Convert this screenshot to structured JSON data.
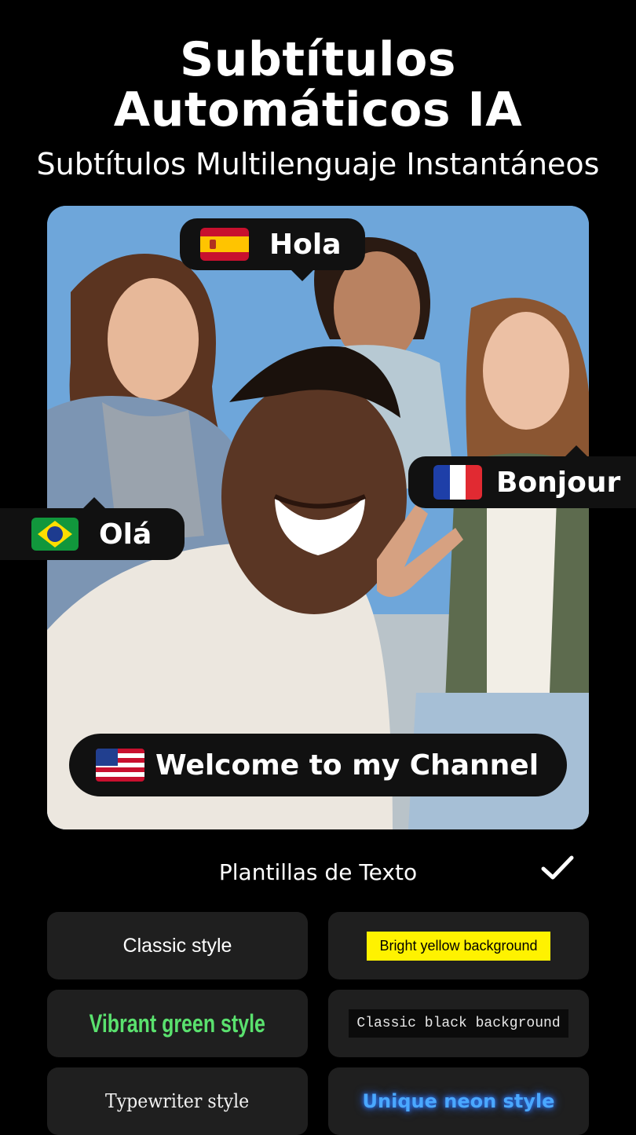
{
  "header": {
    "title_line1": "Subtítulos",
    "title_line2": "Automáticos IA",
    "subtitle": "Subtítulos Multilenguaje Instantáneos"
  },
  "bubbles": {
    "spanish": {
      "text": "Hola",
      "flag": "spain-flag-icon"
    },
    "french": {
      "text": "Bonjour",
      "flag": "france-flag-icon"
    },
    "portuguese": {
      "text": "Olá",
      "flag": "brazil-flag-icon"
    },
    "english": {
      "text": "Welcome to my Channel",
      "flag": "usa-flag-icon"
    }
  },
  "templates": {
    "heading": "Plantillas de Texto",
    "confirm_icon": "checkmark-icon",
    "items": [
      {
        "label": "Classic style"
      },
      {
        "label": "Bright yellow background"
      },
      {
        "label": "Vibrant green style"
      },
      {
        "label": "Classic black background"
      },
      {
        "label": "Typewriter style"
      },
      {
        "label": "Unique neon style"
      }
    ]
  },
  "colors": {
    "background": "#000000",
    "card": "#1f1f1f",
    "yellow": "#fff200",
    "green": "#5ae16e",
    "neon": "#4aa8ff"
  }
}
